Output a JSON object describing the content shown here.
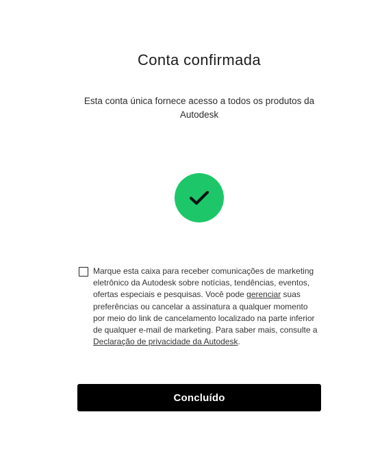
{
  "header": {
    "title": "Conta confirmada",
    "subtitle": "Esta conta única fornece acesso a todos os produtos da Autodesk"
  },
  "status": {
    "icon": "checkmark-icon",
    "color": "#1dc769"
  },
  "consent": {
    "checked": false,
    "text_1": "Marque esta caixa para receber comunicações de marketing eletrônico da Autodesk sobre notícias, tendências, eventos, ofertas especiais e pesquisas. Você pode ",
    "manage_link": "gerenciar",
    "text_2": " suas preferências ou cancelar a assinatura a qualquer momento por meio do link de cancelamento localizado na parte inferior de qualquer e-mail de marketing. Para saber mais, consulte a ",
    "privacy_link": "Declaração de privacidade da Autodesk",
    "text_3": "."
  },
  "actions": {
    "done_label": "Concluído"
  }
}
